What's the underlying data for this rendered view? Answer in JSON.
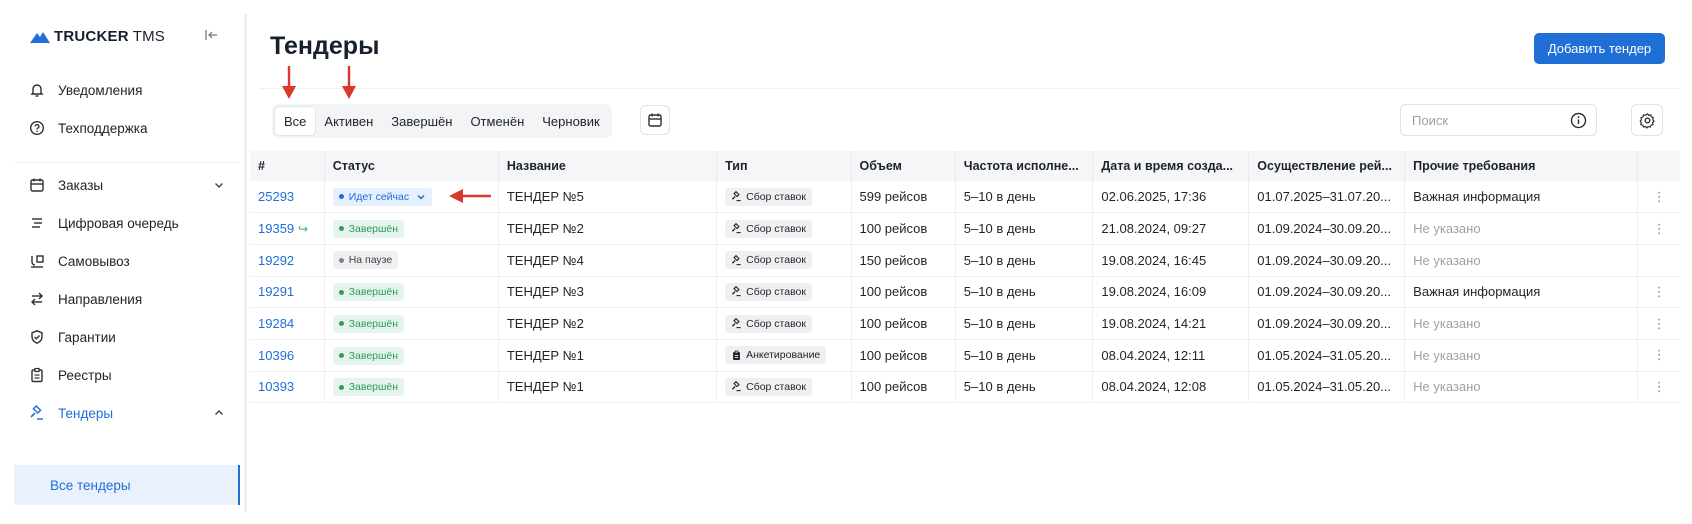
{
  "sidebar": {
    "logo_main": "TRUCKER",
    "logo_suffix": "TMS",
    "items": [
      {
        "label": "Уведомления"
      },
      {
        "label": "Техподдержка"
      },
      {
        "label": "Заказы"
      },
      {
        "label": "Цифровая очередь"
      },
      {
        "label": "Самовывоз"
      },
      {
        "label": "Направления"
      },
      {
        "label": "Гарантии"
      },
      {
        "label": "Реестры"
      },
      {
        "label": "Тендеры"
      }
    ],
    "active_sub": "Все тендеры"
  },
  "header": {
    "title": "Тендеры",
    "add_label": "Добавить тендер"
  },
  "tabs": [
    "Все",
    "Активен",
    "Завершён",
    "Отменён",
    "Черновик"
  ],
  "search": {
    "placeholder": "Поиск"
  },
  "table": {
    "headers": [
      "#",
      "Статус",
      "Название",
      "Тип",
      "Объем",
      "Частота исполне...",
      "Дата и время созда...",
      "Осуществление рей...",
      "Прочие требования"
    ],
    "rows": [
      {
        "id": "25293",
        "status": "Идет сейчас",
        "name": "ТЕНДЕР №5",
        "type": "Сбор ставок",
        "volume": "599 рейсов",
        "freq": "5–10 в день",
        "created": "02.06.2025, 17:36",
        "period": "01.07.2025–31.07.20...",
        "req": "Важная информация"
      },
      {
        "id": "19359",
        "status": "Завершён",
        "name": "ТЕНДЕР №2",
        "type": "Сбор ставок",
        "volume": "100 рейсов",
        "freq": "5–10 в день",
        "created": "21.08.2024, 09:27",
        "period": "01.09.2024–30.09.20...",
        "req": "Не указано"
      },
      {
        "id": "19292",
        "status": "На паузе",
        "name": "ТЕНДЕР №4",
        "type": "Сбор ставок",
        "volume": "150 рейсов",
        "freq": "5–10 в день",
        "created": "19.08.2024, 16:45",
        "period": "01.09.2024–30.09.20...",
        "req": "Не указано"
      },
      {
        "id": "19291",
        "status": "Завершён",
        "name": "ТЕНДЕР №3",
        "type": "Сбор ставок",
        "volume": "100 рейсов",
        "freq": "5–10 в день",
        "created": "19.08.2024, 16:09",
        "period": "01.09.2024–30.09.20...",
        "req": "Важная информация"
      },
      {
        "id": "19284",
        "status": "Завершён",
        "name": "ТЕНДЕР №2",
        "type": "Сбор ставок",
        "volume": "100 рейсов",
        "freq": "5–10 в день",
        "created": "19.08.2024, 14:21",
        "period": "01.09.2024–30.09.20...",
        "req": "Не указано"
      },
      {
        "id": "10396",
        "status": "Завершён",
        "name": "ТЕНДЕР №1",
        "type": "Анкетирование",
        "volume": "100 рейсов",
        "freq": "5–10 в день",
        "created": "08.04.2024, 12:11",
        "period": "01.05.2024–31.05.20...",
        "req": "Не указано"
      },
      {
        "id": "10393",
        "status": "Завершён",
        "name": "ТЕНДЕР №1",
        "type": "Сбор ставок",
        "volume": "100 рейсов",
        "freq": "5–10 в день",
        "created": "08.04.2024, 12:08",
        "period": "01.05.2024–31.05.20...",
        "req": "Не указано"
      }
    ]
  },
  "colors": {
    "accent": "#1f6fd6",
    "arrow": "#d9382b",
    "done": "#2c9a5b"
  }
}
